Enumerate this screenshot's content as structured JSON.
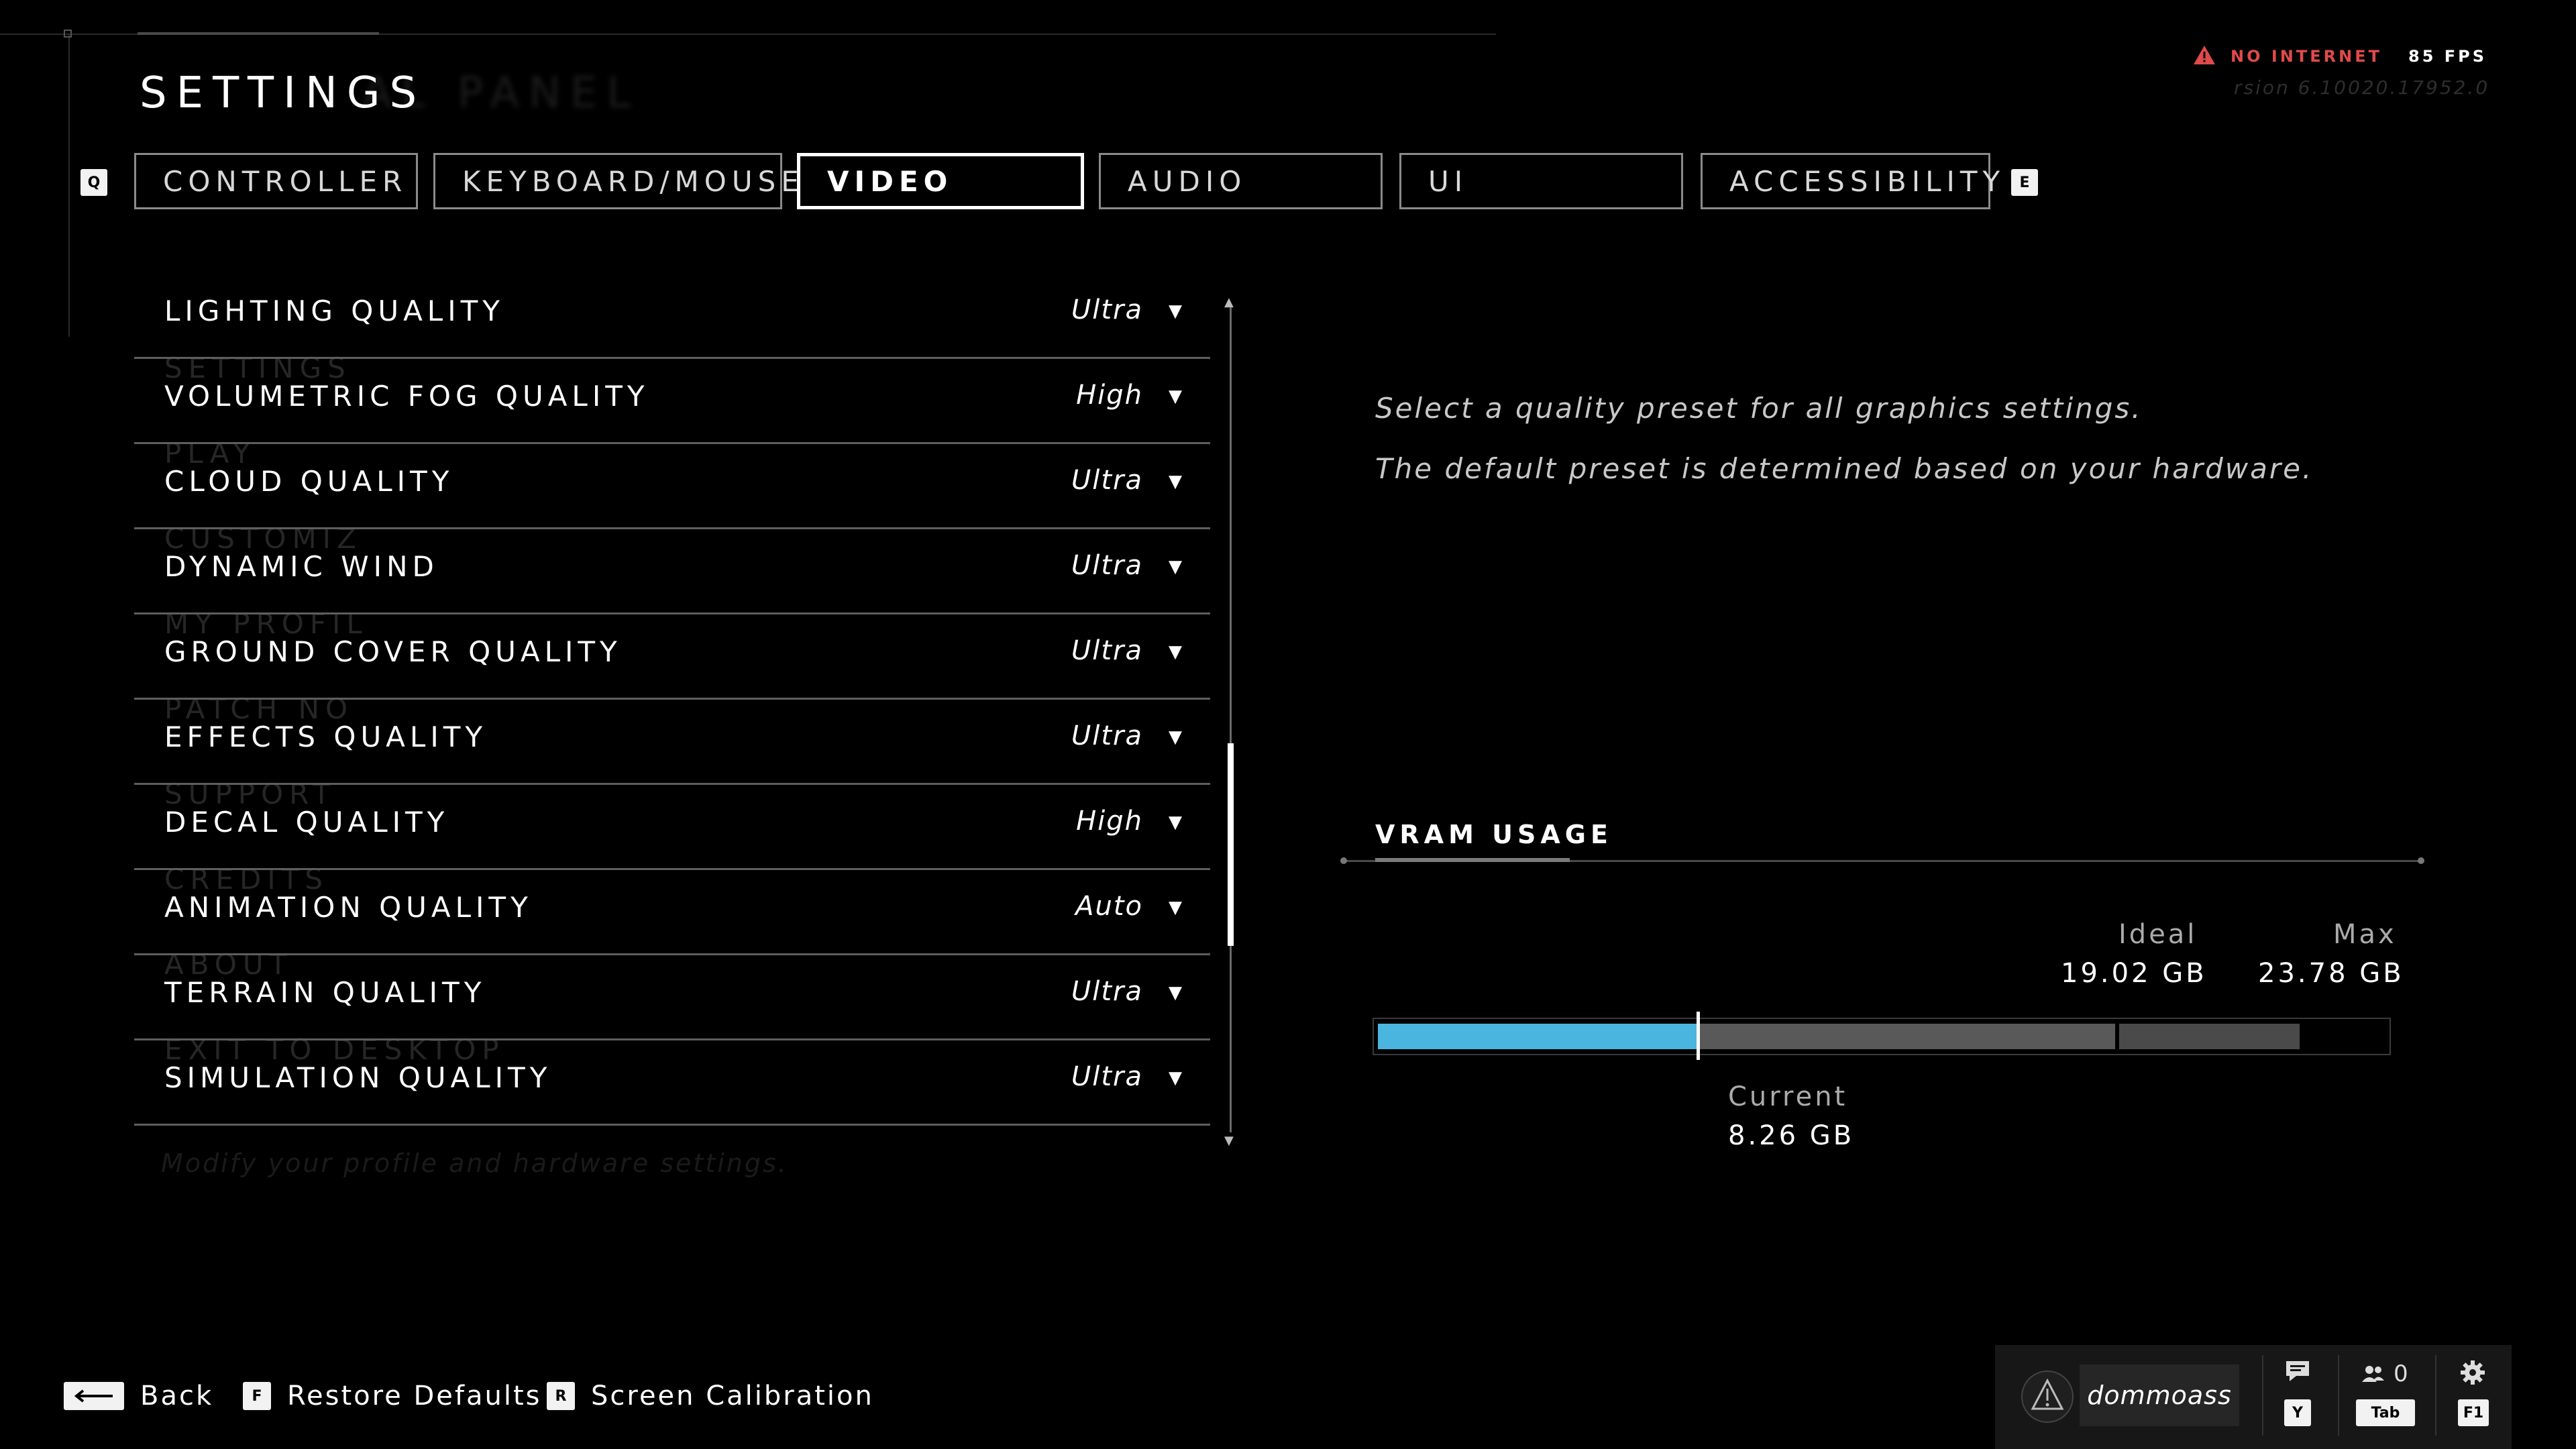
{
  "title": "SETTINGS",
  "ghost_title": "AL PANEL",
  "tabs": {
    "prev_key": "Q",
    "next_key": "E",
    "items": [
      {
        "label": "CONTROLLER"
      },
      {
        "label": "KEYBOARD/MOUSE"
      },
      {
        "label": "VIDEO",
        "active": true
      },
      {
        "label": "AUDIO"
      },
      {
        "label": "UI"
      },
      {
        "label": "ACCESSIBILITY"
      }
    ]
  },
  "settings": [
    {
      "label": "LIGHTING QUALITY",
      "value": "Ultra"
    },
    {
      "label": "VOLUMETRIC FOG QUALITY",
      "value": "High"
    },
    {
      "label": "CLOUD QUALITY",
      "value": "Ultra"
    },
    {
      "label": "DYNAMIC WIND",
      "value": "Ultra"
    },
    {
      "label": "GROUND COVER QUALITY",
      "value": "Ultra"
    },
    {
      "label": "EFFECTS QUALITY",
      "value": "Ultra"
    },
    {
      "label": "DECAL QUALITY",
      "value": "High"
    },
    {
      "label": "ANIMATION QUALITY",
      "value": "Auto"
    },
    {
      "label": "TERRAIN QUALITY",
      "value": "Ultra"
    },
    {
      "label": "SIMULATION QUALITY",
      "value": "Ultra"
    }
  ],
  "ghost_menu": [
    "SETTINGS",
    "PLAY",
    "CUSTOMIZ",
    "MY PROFIL",
    "PATCH NO",
    "SUPPORT",
    "CREDITS",
    "ABOUT",
    "EXIT TO DESKTOP"
  ],
  "ghost_footnote": "Modify your profile and hardware settings.",
  "description": {
    "line1": "Select a quality preset for all graphics settings.",
    "line2": "The default preset is determined based on your hardware."
  },
  "vram": {
    "title": "VRAM USAGE",
    "ideal_label": "Ideal",
    "ideal_value": "19.02 GB",
    "max_label": "Max",
    "max_value": "23.78 GB",
    "current_label": "Current",
    "current_value": "8.26 GB",
    "current_gb": 8.26,
    "ideal_gb": 19.02,
    "max_gb": 23.78,
    "current_color": "#4ab6e0"
  },
  "status": {
    "no_internet": "NO INTERNET",
    "fps": "85 FPS",
    "version": "rsion 6.10020.17952.0",
    "warning_color": "#e04a4a"
  },
  "footer": {
    "back_label": "Back",
    "restore_key": "F",
    "restore_label": "Restore Defaults",
    "calibration_key": "R",
    "calibration_label": "Screen Calibration"
  },
  "user": {
    "username": "dommoass",
    "chat_key": "Y",
    "friends_count": "0",
    "friends_key": "Tab",
    "settings_key": "F1"
  },
  "icons": {
    "warning": "warning-triangle-icon",
    "back": "back-arrow-icon",
    "chat": "chat-icon",
    "friends": "friends-icon",
    "gear": "gear-icon",
    "dropdown": "chevron-down-icon"
  }
}
